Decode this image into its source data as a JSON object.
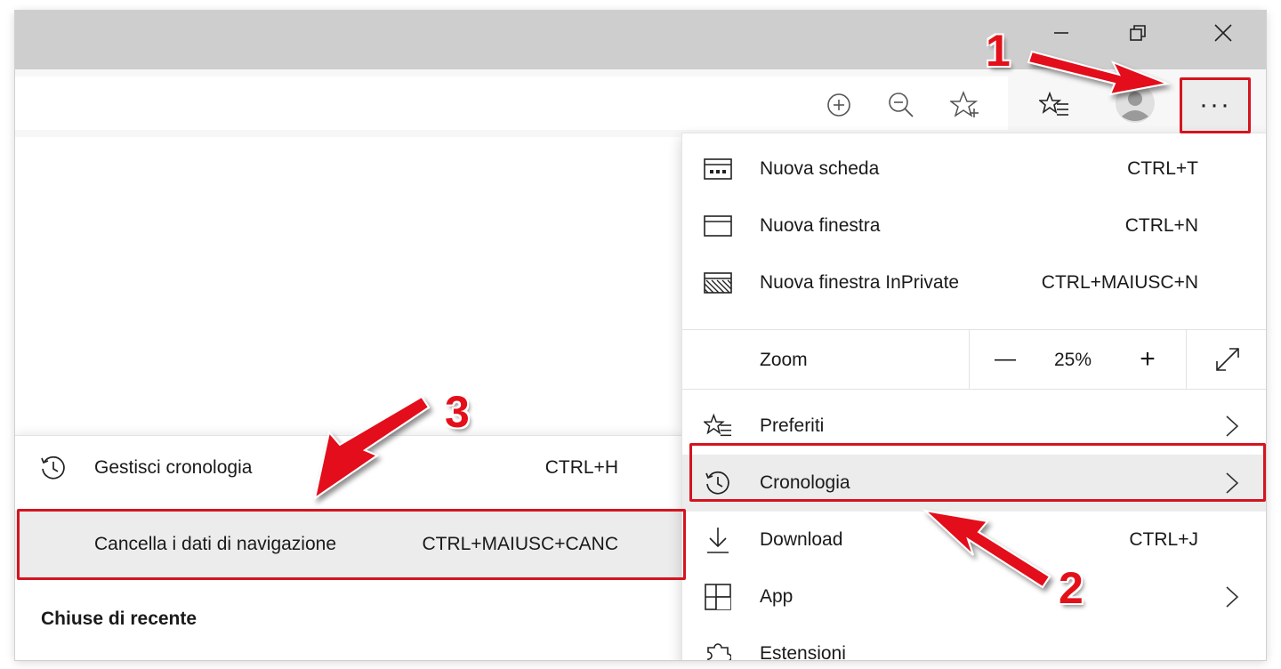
{
  "window_controls": {
    "minimize_icon": "minimize-icon",
    "restore_icon": "restore-icon",
    "close_icon": "close-icon"
  },
  "toolbar": {
    "icons": [
      "zoom-in-icon",
      "zoom-out-icon",
      "add-favorite-icon",
      "favorites-icon",
      "profile-avatar",
      "more-icon"
    ],
    "more_label": "···"
  },
  "menu": {
    "items": [
      {
        "label": "Nuova scheda",
        "shortcut": "CTRL+T",
        "icon": "new-tab-icon"
      },
      {
        "label": "Nuova finestra",
        "shortcut": "CTRL+N",
        "icon": "new-window-icon"
      },
      {
        "label": "Nuova finestra InPrivate",
        "shortcut": "CTRL+MAIUSC+N",
        "icon": "inprivate-icon"
      }
    ],
    "zoom": {
      "label": "Zoom",
      "minus": "—",
      "value": "25%",
      "plus": "+",
      "fullscreen_icon": "fullscreen-icon"
    },
    "items2": [
      {
        "label": "Preferiti",
        "icon": "favorites-icon"
      },
      {
        "label": "Cronologia",
        "icon": "history-icon"
      },
      {
        "label": "Download",
        "shortcut": "CTRL+J",
        "icon": "download-icon"
      },
      {
        "label": "App",
        "icon": "apps-icon"
      },
      {
        "label": "Estensioni",
        "icon": "extensions-icon"
      }
    ]
  },
  "history_submenu": {
    "manage": {
      "label": "Gestisci cronologia",
      "shortcut": "CTRL+H",
      "icon": "history-icon"
    },
    "clear": {
      "label": "Cancella i dati di navigazione",
      "shortcut": "CTRL+MAIUSC+CANC"
    },
    "recently_closed": "Chiuse di recente"
  },
  "annotations": {
    "step1": "1",
    "step2": "2",
    "step3": "3",
    "color": "#e3101a"
  }
}
